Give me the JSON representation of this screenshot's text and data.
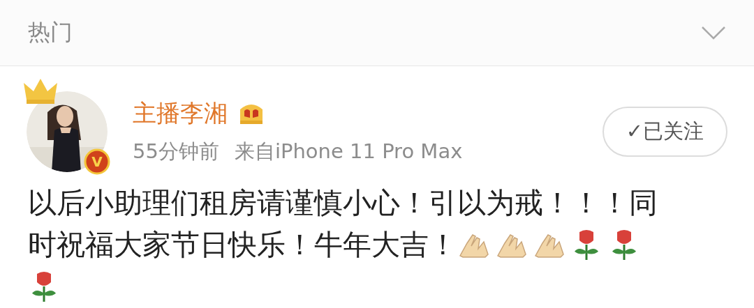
{
  "header": {
    "title": "热门"
  },
  "post": {
    "author": {
      "name": "主播李湘",
      "verified_badge": "V"
    },
    "time": "55分钟前",
    "source": "来自iPhone 11 Pro Max",
    "follow_button": {
      "label": "✓已关注"
    },
    "text_lines": [
      "以后小助理们租房请谨慎小心！引以为戒！！！同",
      "时祝福大家节日快乐！牛年大吉！"
    ],
    "emojis": [
      {
        "kind": "hands"
      },
      {
        "kind": "hands"
      },
      {
        "kind": "hands"
      },
      {
        "kind": "rose"
      },
      {
        "kind": "rose"
      },
      {
        "kind": "rose"
      }
    ]
  }
}
